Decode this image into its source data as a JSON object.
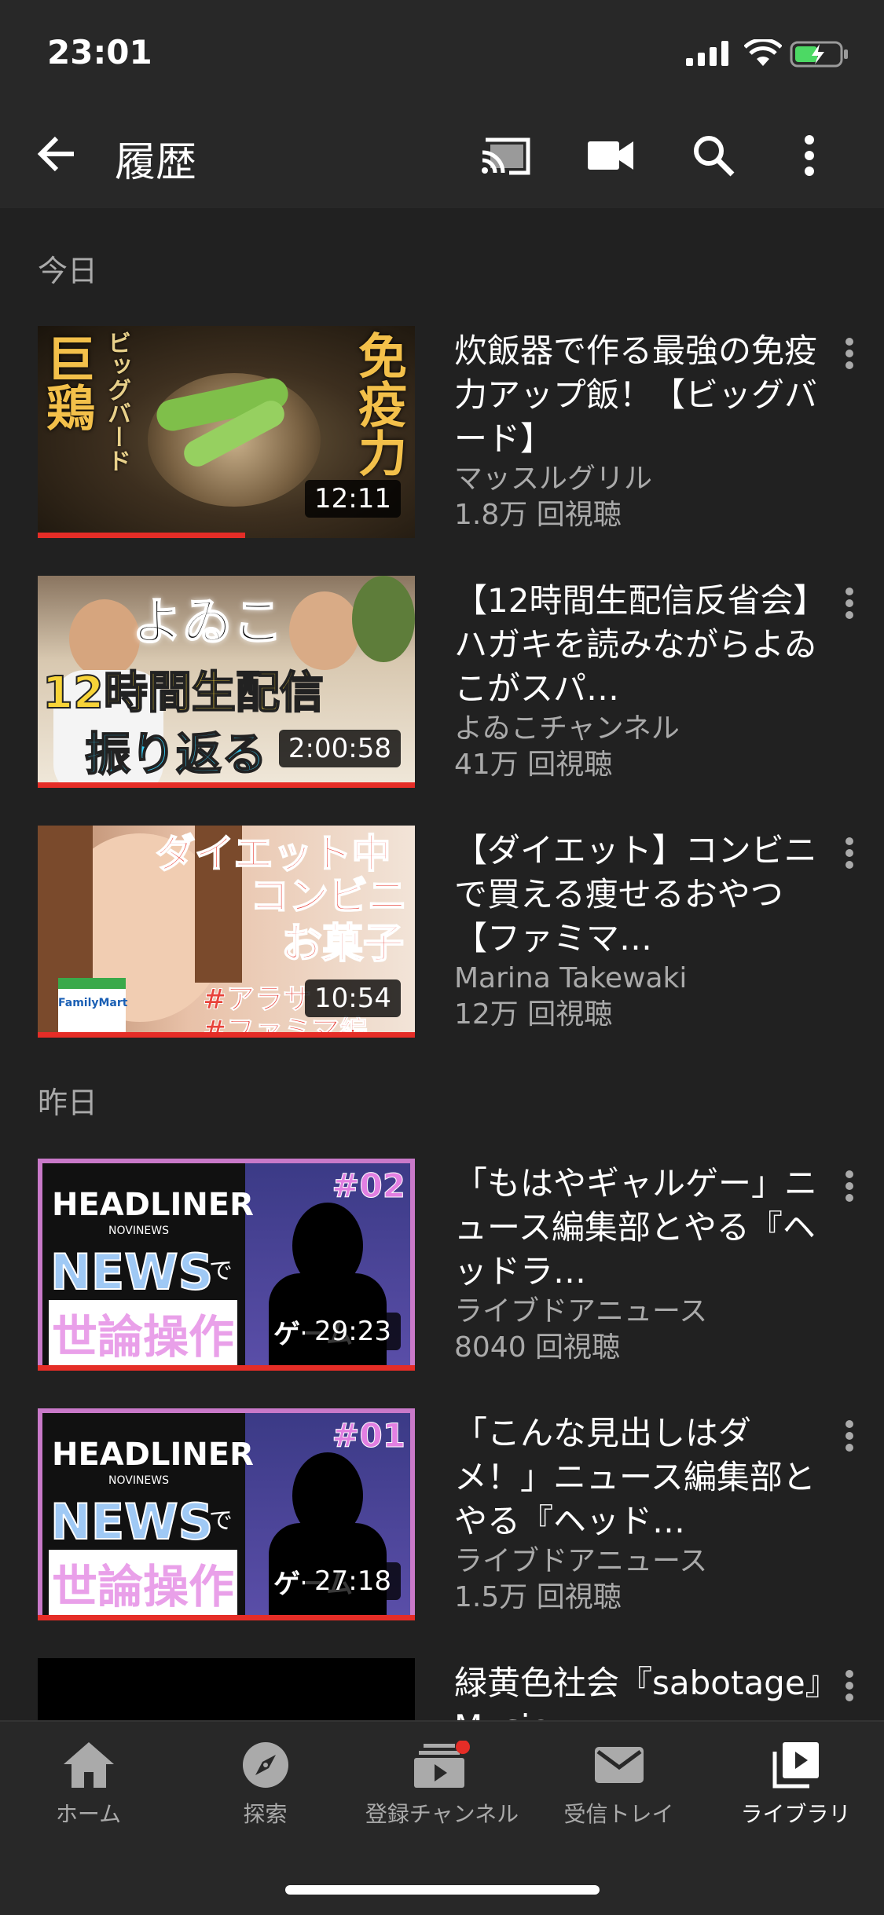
{
  "status": {
    "time": "23:01"
  },
  "header": {
    "title": "履歴"
  },
  "sections": {
    "today": "今日",
    "yesterday": "昨日"
  },
  "videos": [
    {
      "title": "炊飯器で作る最強の免疫力アップ飯！【ビッグバード】",
      "channel": "マッスルグリル",
      "views": "1.8万 回視聴",
      "duration": "12:11",
      "progress": 0.55,
      "thumb_text": [
        "巨鶏",
        "ビッグバード",
        "免疫力"
      ]
    },
    {
      "title": "【12時間生配信反省会】ハガキを読みながらよゐこがスパ…",
      "channel": "よゐこチャンネル",
      "views": "41万 回視聴",
      "duration": "2:00:58",
      "progress": 1.0,
      "thumb_text": [
        "よゐこ",
        "12時間生配信",
        "振り返る"
      ]
    },
    {
      "title": "【ダイエット】コンビニで買える痩せるおやつ【ファミマ…",
      "channel": "Marina Takewaki",
      "views": "12万 回視聴",
      "duration": "10:54",
      "progress": 1.0,
      "thumb_text": [
        "ダイエット中",
        "コンビニ",
        "お菓子",
        "#アラサ",
        "#ファミマ編",
        "FamilyMart"
      ]
    },
    {
      "title": "「もはやギャルゲー」ニュース編集部とやる『ヘッドラ…",
      "channel": "ライブドアニュース",
      "views": "8040 回視聴",
      "duration": "29:23",
      "progress": 1.0,
      "thumb_text": [
        "HEADLINER",
        "NOVINEWS",
        "NEWS",
        "で",
        "世論操作",
        "ゲーム",
        "#02"
      ]
    },
    {
      "title": "「こんな見出しはダメ！」ニュース編集部とやる『ヘッド…",
      "channel": "ライブドアニュース",
      "views": "1.5万 回視聴",
      "duration": "27:18",
      "progress": 1.0,
      "thumb_text": [
        "HEADLINER",
        "NOVINEWS",
        "NEWS",
        "で",
        "世論操作",
        "ゲーム",
        "#01"
      ]
    },
    {
      "title": "緑黄色社会『sabotage』Music",
      "channel": "",
      "views": "",
      "duration": "",
      "progress": 0
    }
  ],
  "nav": [
    {
      "label": "ホーム",
      "icon": "home-icon"
    },
    {
      "label": "探索",
      "icon": "explore-icon"
    },
    {
      "label": "登録チャンネル",
      "icon": "subscriptions-icon"
    },
    {
      "label": "受信トレイ",
      "icon": "inbox-icon"
    },
    {
      "label": "ライブラリ",
      "icon": "library-icon"
    }
  ],
  "colors": {
    "accent": "#e52d27",
    "background": "#212121",
    "bar": "#282828",
    "secondary_text": "#aaaaaa"
  }
}
